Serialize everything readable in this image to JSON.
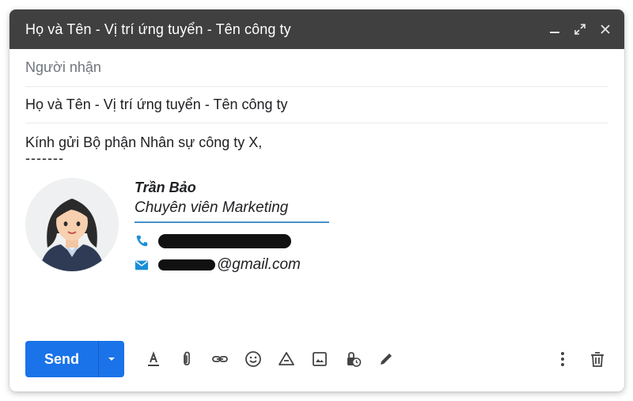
{
  "window": {
    "title": "Họ và Tên - Vị trí ứng tuyển - Tên công ty",
    "controls": [
      "minimize-icon",
      "expand-icon",
      "close-icon"
    ]
  },
  "recipients": {
    "placeholder": "Người nhận"
  },
  "subject": {
    "value": "Họ và Tên - Vị trí ứng tuyển - Tên công ty"
  },
  "body": {
    "greeting": "Kính gửi Bộ phận Nhân sự công ty X,",
    "separator": "-------"
  },
  "signature": {
    "name": "Trần Bảo",
    "role": "Chuyên viên Marketing",
    "email_domain": "@gmail.com",
    "divider_color": "#4a90c8",
    "icon_color": "#1a8fd6"
  },
  "toolbar": {
    "send_label": "Send",
    "accent": "#1a73e8",
    "tools": [
      "format-text-icon",
      "attach-icon",
      "link-icon",
      "emoji-icon",
      "drive-icon",
      "image-icon",
      "confidential-icon",
      "signature-icon"
    ],
    "right_tools": [
      "more-options-icon",
      "trash-icon"
    ]
  }
}
